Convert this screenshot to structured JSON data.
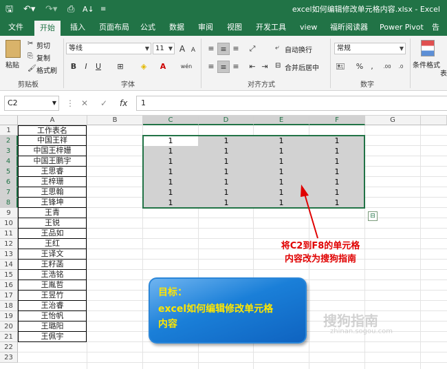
{
  "window": {
    "title": "excel如何编辑修改单元格内容.xlsx  -  Excel"
  },
  "quick_access": {
    "save_icon": "save-icon",
    "undo_icon": "undo-icon",
    "redo_icon": "redo-icon",
    "print_preview_icon": "print-preview-icon",
    "sort_icon": "sort-icon",
    "customize_icon": "customize-icon"
  },
  "tabs": [
    "文件",
    "开始",
    "插入",
    "页面布局",
    "公式",
    "数据",
    "审阅",
    "视图",
    "开发工具",
    "view",
    "福昕阅读器",
    "Power Pivot",
    "告"
  ],
  "ribbon": {
    "clipboard": {
      "paste": "粘贴",
      "cut": "剪切",
      "copy": "复制",
      "format_painter": "格式刷",
      "label": "剪贴板"
    },
    "font": {
      "name": "等线",
      "size": "11",
      "bold": "B",
      "italic": "I",
      "underline": "U",
      "grow": "A",
      "shrink": "A",
      "phonetic": "wén",
      "label": "字体"
    },
    "alignment": {
      "wrap": "自动换行",
      "merge": "合并后居中",
      "label": "对齐方式"
    },
    "number": {
      "format": "常规",
      "percent": "%",
      "comma": ",",
      "label": "数字"
    },
    "styles": {
      "conditional": "条件格式",
      "table": "表"
    }
  },
  "formula_bar": {
    "name_box": "C2",
    "fx": "fx",
    "value": "1"
  },
  "columns": [
    "A",
    "B",
    "C",
    "D",
    "E",
    "F",
    "G"
  ],
  "rows": [
    "1",
    "2",
    "3",
    "4",
    "5",
    "6",
    "7",
    "8",
    "9",
    "10",
    "11",
    "12",
    "13",
    "14",
    "15",
    "16",
    "17",
    "18",
    "19",
    "20",
    "21",
    "22",
    "23"
  ],
  "column_a": [
    "工作表名",
    "中国王祥",
    "中国王梓姗",
    "中国王鹏宇",
    "王思睿",
    "王梓珊",
    "王思翰",
    "王锋坤",
    "王青",
    "王锐",
    "王品如",
    "王红",
    "王译文",
    "王籽菡",
    "王浩铭",
    "王胤哲",
    "王昱竹",
    "王治睿",
    "王怡帆",
    "王璐阳",
    "王佩宇"
  ],
  "grid_values": {
    "r2": [
      "1",
      "1",
      "1",
      "1"
    ],
    "r3": [
      "1",
      "1",
      "1",
      "1"
    ],
    "r4": [
      "1",
      "1",
      "1",
      "1"
    ],
    "r5": [
      "1",
      "1",
      "1",
      "1"
    ],
    "r6": [
      "1",
      "1",
      "1",
      "1"
    ],
    "r7": [
      "1",
      "1",
      "1",
      "1"
    ],
    "r8": [
      "1",
      "1",
      "1",
      "1"
    ]
  },
  "annotations": {
    "instruction_line1": "将C2到F8的单元格",
    "instruction_line2": "内容改为搜狗指南",
    "goal_line1": "目标：",
    "goal_line2": "excel如何编辑修改单元格",
    "goal_line3": "内容",
    "watermark": "搜狗指南",
    "watermark_url": "zhinan.sogou.com"
  },
  "colors": {
    "excel_green": "#217346",
    "annotation_red": "#e00000",
    "goal_text": "#ffe600",
    "goal_box": "#1a7fd8"
  }
}
